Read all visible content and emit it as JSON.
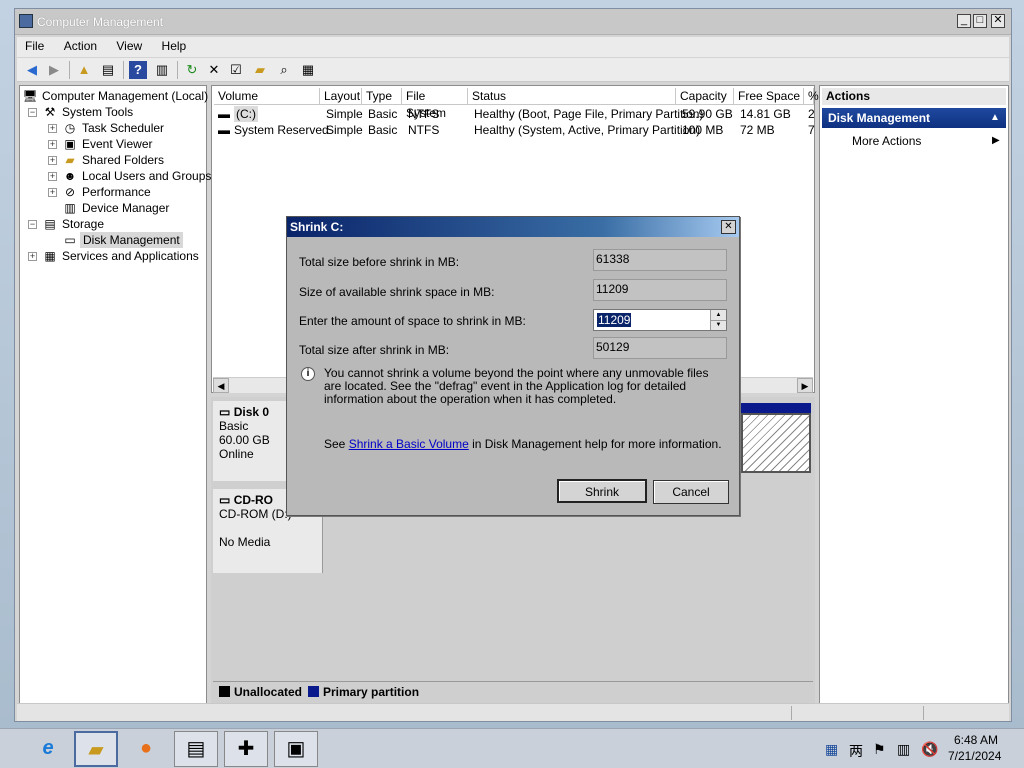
{
  "window": {
    "title": "Computer Management",
    "min_icon": "minimize-icon",
    "max_icon": "maximize-icon",
    "close_icon": "close-icon"
  },
  "menu": [
    "File",
    "Action",
    "View",
    "Help"
  ],
  "toolbar_icons": [
    "back-arrow-icon",
    "forward-arrow-icon",
    "up-folder-icon",
    "show-hide-tree-icon",
    "help-icon",
    "properties-pane-icon",
    "refresh-icon",
    "delete-icon",
    "properties-icon",
    "open-icon",
    "search-icon",
    "disk-icon"
  ],
  "tree": {
    "root": "Computer Management (Local)",
    "system_tools": "System Tools",
    "task_scheduler": "Task Scheduler",
    "event_viewer": "Event Viewer",
    "shared_folders": "Shared Folders",
    "local_users": "Local Users and Groups",
    "performance": "Performance",
    "device_manager": "Device Manager",
    "storage": "Storage",
    "disk_management": "Disk Management",
    "services": "Services and Applications"
  },
  "volumes": {
    "headers": [
      "Volume",
      "Layout",
      "Type",
      "File System",
      "Status",
      "Capacity",
      "Free Space",
      "%"
    ],
    "rows": [
      [
        "(C:)",
        "Simple",
        "Basic",
        "NTFS",
        "Healthy (Boot, Page File, Primary Partition)",
        "59.90 GB",
        "14.81 GB",
        "2"
      ],
      [
        "System Reserved",
        "Simple",
        "Basic",
        "NTFS",
        "Healthy (System, Active, Primary Partition)",
        "100 MB",
        "72 MB",
        "7"
      ]
    ]
  },
  "graph": {
    "disk0": {
      "name": "Disk 0",
      "type": "Basic",
      "size": "60.00 GB",
      "status": "Online"
    },
    "cdrom": {
      "name": "CD-RO",
      "drive": "CD-ROM (D:)",
      "media": "No Media"
    },
    "legend": {
      "unallocated": "Unallocated",
      "primary": "Primary partition"
    },
    "colors": {
      "unallocated": "#000000",
      "primary": "#0a1a8c"
    }
  },
  "actions": {
    "header": "Actions",
    "section": "Disk Management",
    "more": "More Actions"
  },
  "dialog": {
    "title": "Shrink C:",
    "total_before_label": "Total size before shrink in MB:",
    "total_before_value": "61338",
    "available_label": "Size of available shrink space in MB:",
    "available_value": "11209",
    "amount_label": "Enter the amount of space to shrink in MB:",
    "amount_value": "11209",
    "after_label": "Total size after shrink in MB:",
    "after_value": "50129",
    "info_text": "You cannot shrink a volume beyond the point where any unmovable files are located. See the \"defrag\" event in the Application log for detailed information about the operation when it has completed.",
    "help_prefix": "See ",
    "help_link": "Shrink a Basic Volume",
    "help_suffix": " in Disk Management help for more information.",
    "shrink_button": "Shrink",
    "cancel_button": "Cancel"
  },
  "taskbar": {
    "apps": [
      "internet-explorer-icon",
      "file-explorer-icon",
      "firefox-icon",
      "server-manager-icon",
      "control-panel-icon",
      "computer-management-icon"
    ],
    "time": "6:48 AM",
    "date": "7/21/2024"
  }
}
